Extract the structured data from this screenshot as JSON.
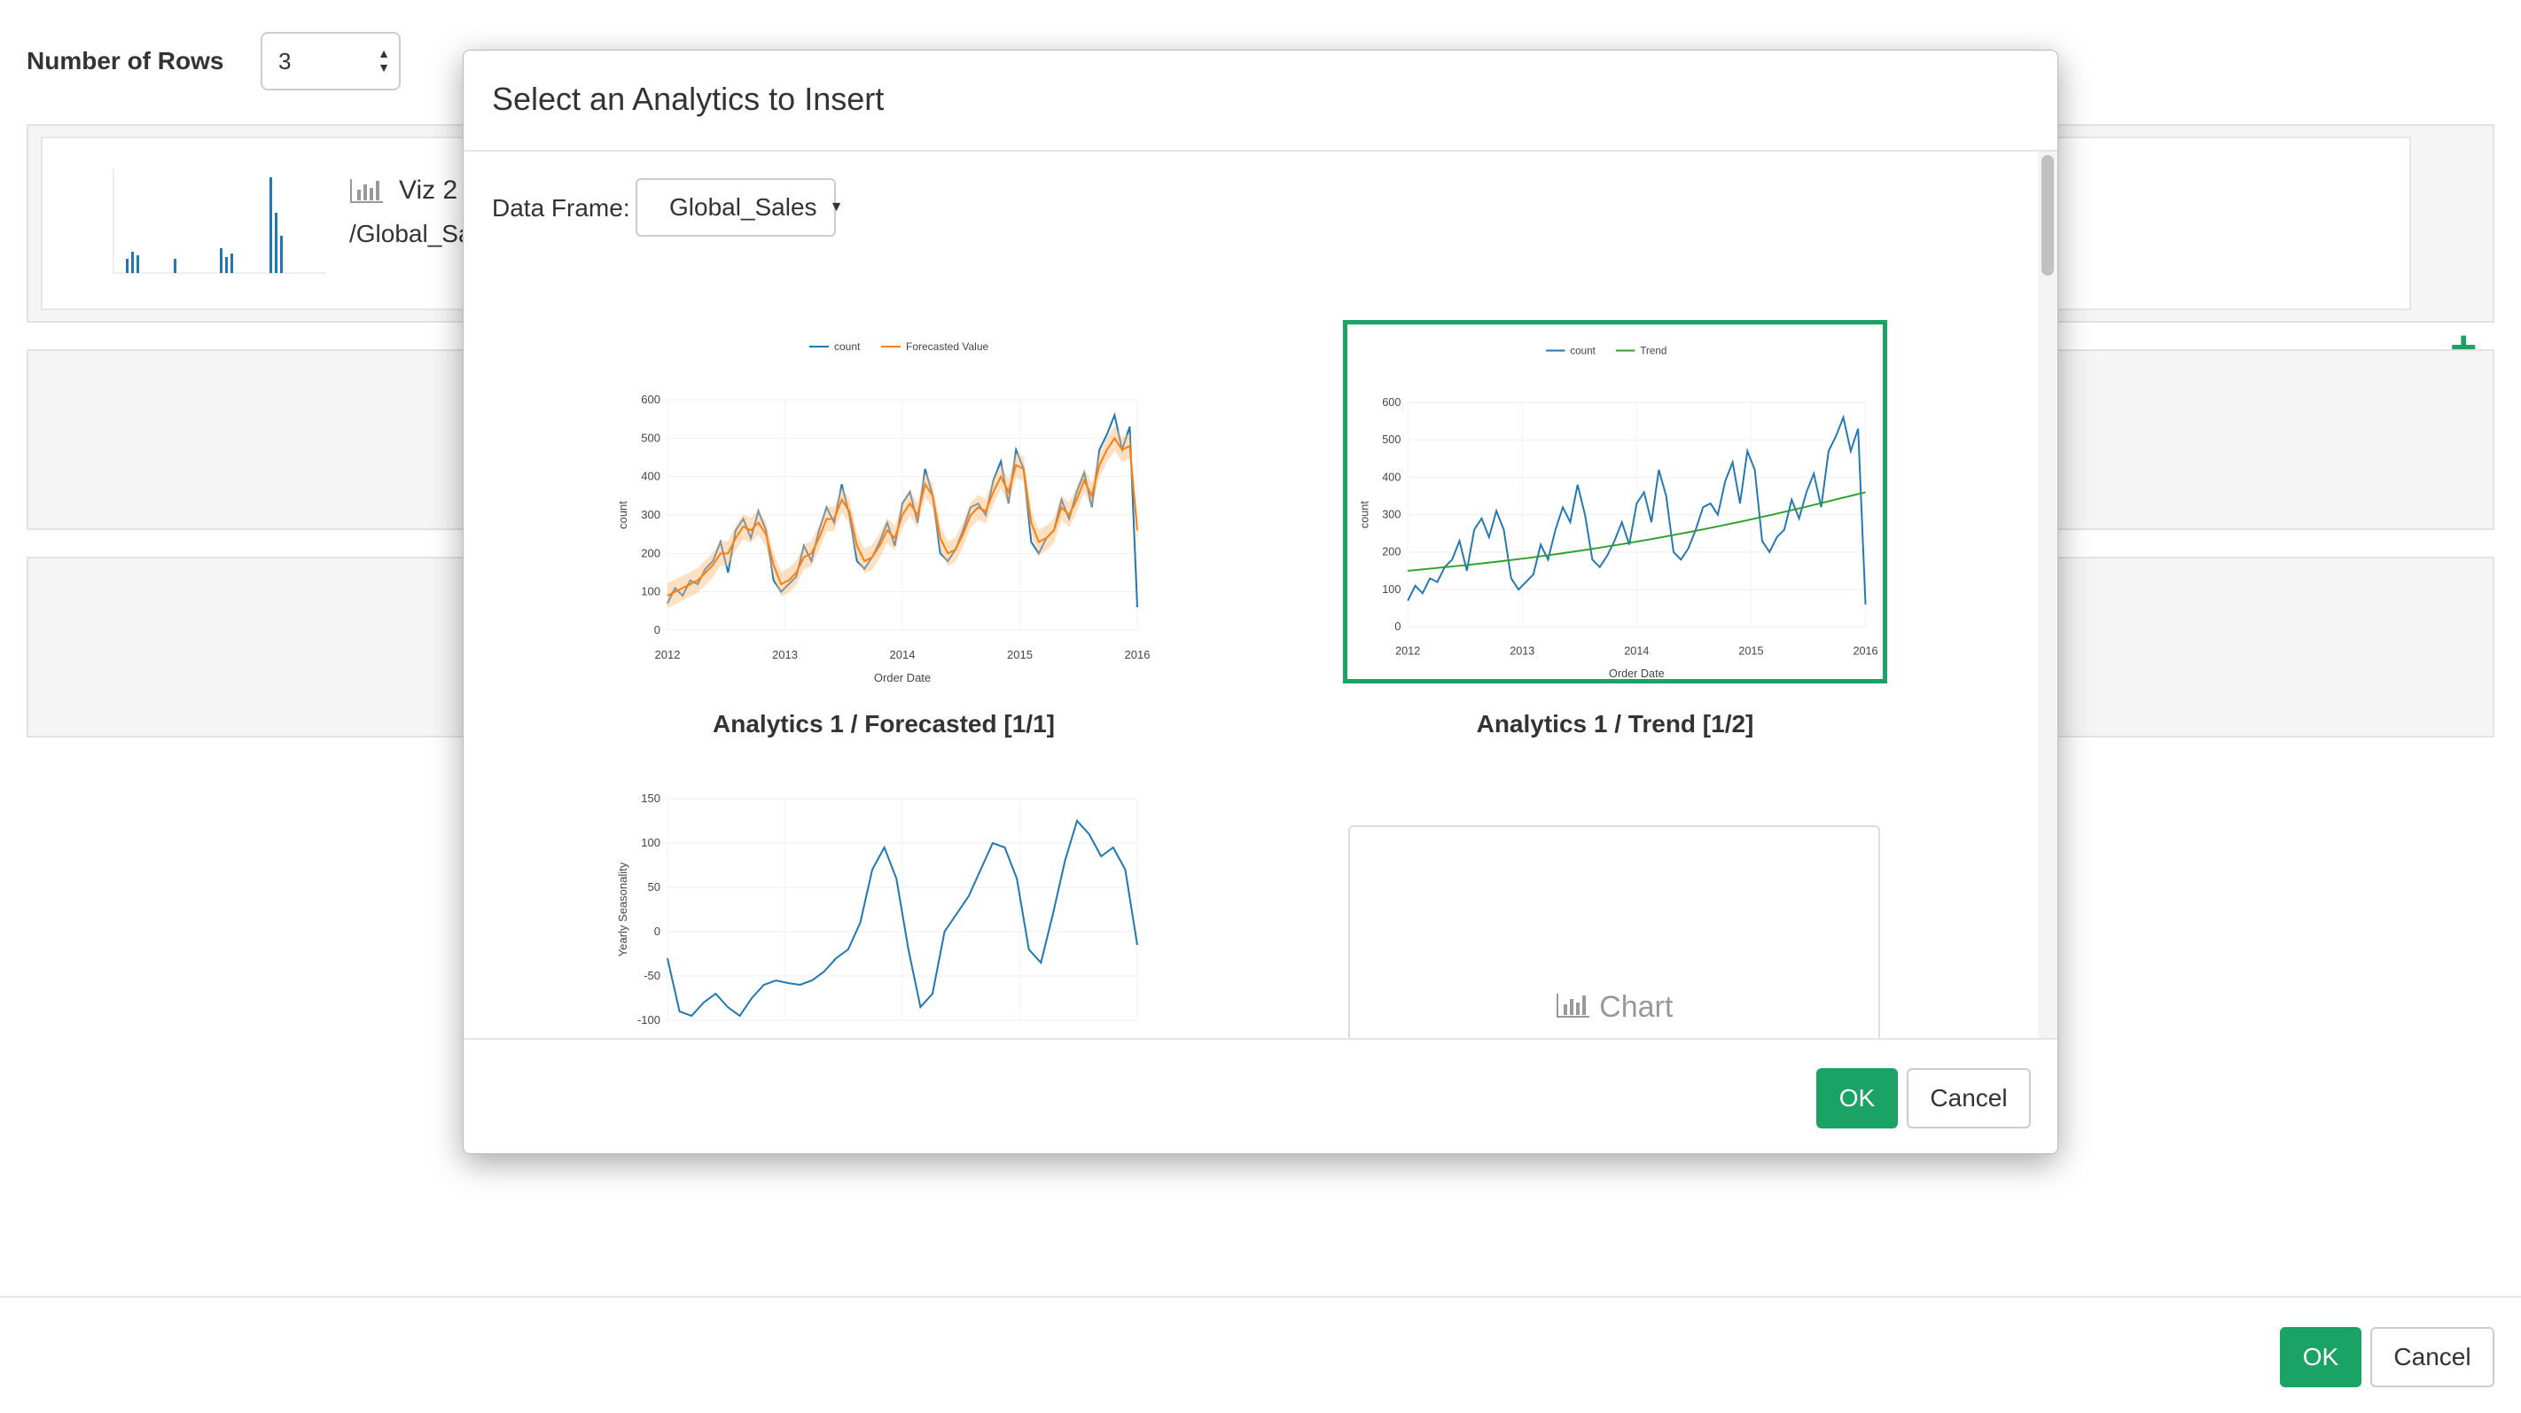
{
  "page": {
    "rows_label": "Number of Rows",
    "rows_value": "3",
    "viz": {
      "title": "Viz 2",
      "path": "/Global_Sa"
    },
    "ok_label": "OK",
    "cancel_label": "Cancel"
  },
  "modal": {
    "title": "Select an Analytics to Insert",
    "data_frame_label": "Data Frame:",
    "data_frame_value": "Global_Sales",
    "empty_chart_label": "Chart",
    "ok_label": "OK",
    "cancel_label": "Cancel",
    "cards": [
      {
        "label": "Analytics 1 / Forecasted [1/1]",
        "selected": false
      },
      {
        "label": "Analytics 1 / Trend [1/2]",
        "selected": true
      },
      {
        "label": "",
        "selected": false
      }
    ]
  },
  "colors": {
    "accent": "#1aa364",
    "series_blue": "#1f77b4",
    "series_orange": "#ff7f0e",
    "trend_green": "#2ca02c"
  },
  "chart_data": [
    {
      "type": "line",
      "legend": [
        "count",
        "Forecasted Value"
      ],
      "ylabel": "count",
      "xlabel": "Order Date",
      "x_ticks": [
        "2012",
        "2013",
        "2014",
        "2015",
        "2016"
      ],
      "y_ticks": [
        0,
        100,
        200,
        300,
        400,
        500,
        600
      ],
      "ylim": [
        0,
        600
      ],
      "series": [
        {
          "name": "count",
          "values": [
            70,
            110,
            90,
            130,
            120,
            160,
            180,
            230,
            150,
            260,
            290,
            240,
            310,
            260,
            130,
            100,
            120,
            140,
            220,
            180,
            260,
            320,
            280,
            380,
            300,
            180,
            160,
            190,
            230,
            280,
            220,
            330,
            360,
            280,
            420,
            350,
            200,
            180,
            210,
            260,
            320,
            330,
            300,
            390,
            440,
            330,
            470,
            420,
            230,
            200,
            240,
            260,
            340,
            290,
            360,
            410,
            320,
            470,
            510,
            560,
            470,
            530,
            60
          ]
        },
        {
          "name": "Forecasted Value",
          "values": [
            90,
            100,
            110,
            120,
            130,
            150,
            170,
            200,
            200,
            240,
            270,
            260,
            280,
            250,
            170,
            120,
            130,
            150,
            190,
            200,
            240,
            290,
            290,
            340,
            310,
            220,
            180,
            190,
            220,
            260,
            240,
            300,
            330,
            300,
            380,
            350,
            240,
            200,
            210,
            250,
            300,
            320,
            310,
            360,
            400,
            360,
            430,
            420,
            280,
            230,
            240,
            260,
            320,
            300,
            340,
            390,
            350,
            430,
            470,
            500,
            470,
            480,
            260
          ]
        }
      ]
    },
    {
      "type": "line",
      "legend": [
        "count",
        "Trend"
      ],
      "ylabel": "count",
      "xlabel": "Order Date",
      "x_ticks": [
        "2012",
        "2013",
        "2014",
        "2015",
        "2016"
      ],
      "y_ticks": [
        0,
        100,
        200,
        300,
        400,
        500,
        600
      ],
      "ylim": [
        0,
        600
      ],
      "series": [
        {
          "name": "count",
          "values": [
            70,
            110,
            90,
            130,
            120,
            160,
            180,
            230,
            150,
            260,
            290,
            240,
            310,
            260,
            130,
            100,
            120,
            140,
            220,
            180,
            260,
            320,
            280,
            380,
            300,
            180,
            160,
            190,
            230,
            280,
            220,
            330,
            360,
            280,
            420,
            350,
            200,
            180,
            210,
            260,
            320,
            330,
            300,
            390,
            440,
            330,
            470,
            420,
            230,
            200,
            240,
            260,
            340,
            290,
            360,
            410,
            320,
            470,
            510,
            560,
            470,
            530,
            60
          ]
        },
        {
          "name": "Trend",
          "values": [
            150,
            158,
            166,
            175,
            185,
            196,
            208,
            221,
            235,
            250,
            266,
            283,
            301,
            320,
            340,
            360
          ]
        }
      ]
    },
    {
      "type": "line",
      "ylabel": "Yearly Seasonality",
      "y_ticks": [
        -100,
        -50,
        0,
        50,
        100,
        150
      ],
      "ylim": [
        -100,
        150
      ],
      "series": [
        {
          "name": "",
          "values": [
            -30,
            -90,
            -95,
            -80,
            -70,
            -85,
            -95,
            -75,
            -60,
            -55,
            -58,
            -60,
            -55,
            -45,
            -30,
            -20,
            10,
            70,
            95,
            60,
            -20,
            -85,
            -70,
            0,
            20,
            40,
            70,
            100,
            95,
            60,
            -20,
            -35,
            20,
            80,
            125,
            110,
            85,
            95,
            70,
            -15
          ]
        }
      ]
    }
  ]
}
